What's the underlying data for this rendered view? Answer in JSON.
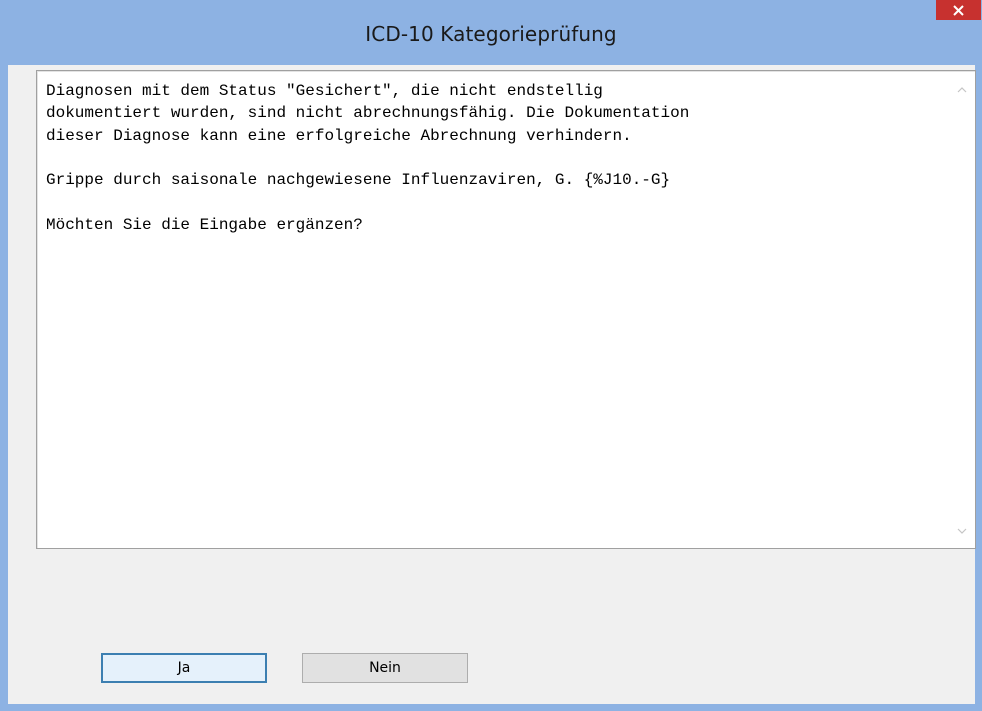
{
  "window": {
    "title": "ICD-10 Kategorieprüfung",
    "close_icon": "close-icon"
  },
  "message": {
    "lines": [
      "Diagnosen mit dem Status \"Gesichert\", die nicht endstellig",
      "dokumentiert wurden, sind nicht abrechnungsfähig. Die Dokumentation",
      "dieser Diagnose kann eine erfolgreiche Abrechnung verhindern.",
      "Grippe durch saisonale nachgewiesene Influenzaviren, G. {%J10.-G}",
      "Möchten Sie die Eingabe ergänzen?"
    ],
    "scroll_up_icon": "chevron-up-icon",
    "scroll_down_icon": "chevron-down-icon"
  },
  "buttons": {
    "yes_label": "Ja",
    "no_label": "Nein"
  },
  "colors": {
    "titlebar": "#8db2e3",
    "close_button": "#c7312f",
    "dialog_background": "#f0f0f0",
    "default_button_border": "#3c7fb1"
  }
}
